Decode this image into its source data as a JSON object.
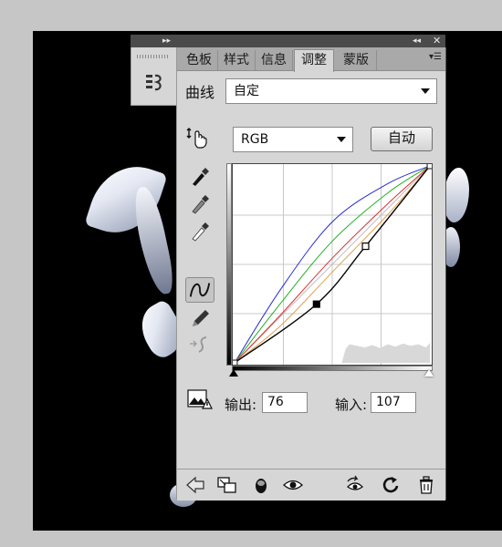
{
  "tabs": [
    {
      "label": "色板"
    },
    {
      "label": "样式"
    },
    {
      "label": "信息"
    },
    {
      "label": "调整"
    },
    {
      "label": "蒙版"
    }
  ],
  "panel_title": "曲线",
  "preset": {
    "value": "自定"
  },
  "channel": {
    "value": "RGB"
  },
  "auto_button": "自动",
  "output": {
    "label": "输出:",
    "value": "76"
  },
  "input": {
    "label": "输入:",
    "value": "107"
  },
  "chart_data": {
    "type": "line",
    "title": "",
    "xlim": [
      0,
      255
    ],
    "ylim": [
      0,
      255
    ],
    "grid": true,
    "series": [
      {
        "color": "#000000",
        "points": [
          [
            0,
            0
          ],
          [
            107,
            76
          ],
          [
            171,
            151
          ],
          [
            255,
            255
          ]
        ]
      },
      {
        "color": "#2a2ad0",
        "points": [
          [
            0,
            0
          ],
          [
            60,
            95
          ],
          [
            128,
            183
          ],
          [
            200,
            232
          ],
          [
            255,
            255
          ]
        ]
      },
      {
        "color": "#1fb01f",
        "points": [
          [
            0,
            0
          ],
          [
            60,
            77
          ],
          [
            128,
            158
          ],
          [
            200,
            220
          ],
          [
            255,
            255
          ]
        ]
      },
      {
        "color": "#d83030",
        "points": [
          [
            0,
            0
          ],
          [
            60,
            62
          ],
          [
            128,
            136
          ],
          [
            200,
            206
          ],
          [
            255,
            255
          ]
        ]
      },
      {
        "color": "#e3a04f",
        "points": [
          [
            0,
            0
          ],
          [
            60,
            48
          ],
          [
            128,
            118
          ],
          [
            200,
            192
          ],
          [
            255,
            255
          ]
        ]
      }
    ],
    "control_points": [
      {
        "x": 107,
        "y": 76,
        "selected": true
      },
      {
        "x": 171,
        "y": 151,
        "selected": false
      }
    ]
  },
  "colors": {
    "panel_bg": "#d6d6d6",
    "tab_bar": "#a9a9a9",
    "title_bar": "#4b4b4b",
    "canvas": "#000000"
  }
}
